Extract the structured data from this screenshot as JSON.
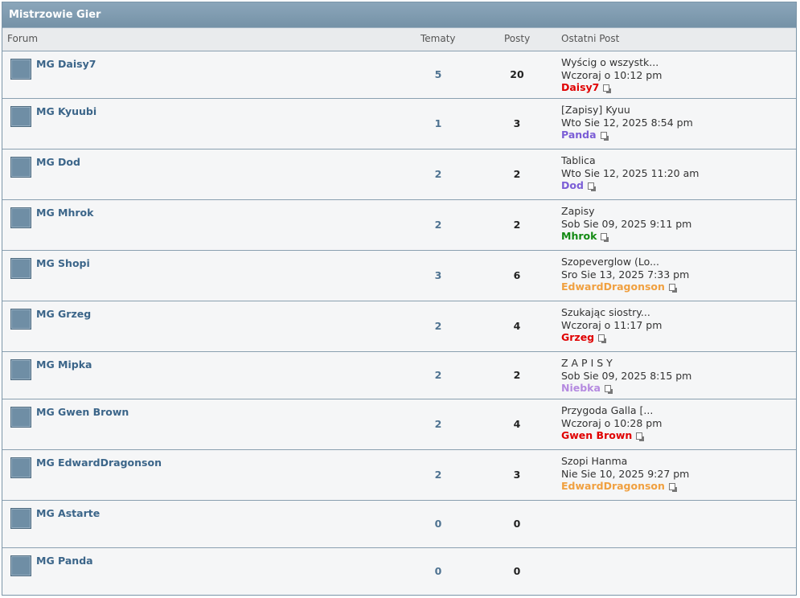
{
  "category": {
    "title": "Mistrzowie Gier"
  },
  "columns": {
    "forum": "Forum",
    "topics": "Tematy",
    "posts": "Posty",
    "last_post": "Ostatni Post"
  },
  "forums": [
    {
      "name": "MG Daisy7",
      "topics": "5",
      "posts": "20",
      "last_title": "Wyścig o wszystk...",
      "last_date": "Wczoraj o 10:12 pm",
      "last_author": "Daisy7",
      "author_color": "#e00000"
    },
    {
      "name": "MG Kyuubi",
      "topics": "1",
      "posts": "3",
      "last_title": "[Zapisy] Kyuu",
      "last_date": "Wto Sie 12, 2025 8:54 pm",
      "last_author": "Panda",
      "author_color": "#7b5ed6"
    },
    {
      "name": "MG Dod",
      "topics": "2",
      "posts": "2",
      "last_title": "Tablica",
      "last_date": "Wto Sie 12, 2025 11:20 am",
      "last_author": "Dod",
      "author_color": "#7b5ed6"
    },
    {
      "name": "MG Mhrok",
      "topics": "2",
      "posts": "2",
      "last_title": "Zapisy",
      "last_date": "Sob Sie 09, 2025 9:11 pm",
      "last_author": "Mhrok",
      "author_color": "#138a13"
    },
    {
      "name": "MG Shopi",
      "topics": "3",
      "posts": "6",
      "last_title": "Szopeverglow (Lo...",
      "last_date": "Sro Sie 13, 2025 7:33 pm",
      "last_author": "EdwardDragonson",
      "author_color": "#f0a040"
    },
    {
      "name": "MG Grzeg",
      "topics": "2",
      "posts": "4",
      "last_title": "Szukając siostry...",
      "last_date": "Wczoraj o 11:17 pm",
      "last_author": "Grzeg",
      "author_color": "#e00000"
    },
    {
      "name": "MG Mipka",
      "topics": "2",
      "posts": "2",
      "last_title": "Z A P I S Y",
      "last_date": "Sob Sie 09, 2025 8:15 pm",
      "last_author": "Niebka",
      "author_color": "#b58ae0"
    },
    {
      "name": "MG Gwen Brown",
      "topics": "2",
      "posts": "4",
      "last_title": "Przygoda Galla [...",
      "last_date": "Wczoraj o 10:28 pm",
      "last_author": "Gwen Brown",
      "author_color": "#e00000"
    },
    {
      "name": "MG EdwardDragonson",
      "topics": "2",
      "posts": "3",
      "last_title": "Szopi Hanma",
      "last_date": "Nie Sie 10, 2025 9:27 pm",
      "last_author": "EdwardDragonson",
      "author_color": "#f0a040"
    },
    {
      "name": "MG Astarte",
      "topics": "0",
      "posts": "0",
      "last_title": "",
      "last_date": "",
      "last_author": "",
      "author_color": ""
    },
    {
      "name": "MG Panda",
      "topics": "0",
      "posts": "0",
      "last_title": "",
      "last_date": "",
      "last_author": "",
      "author_color": ""
    }
  ]
}
